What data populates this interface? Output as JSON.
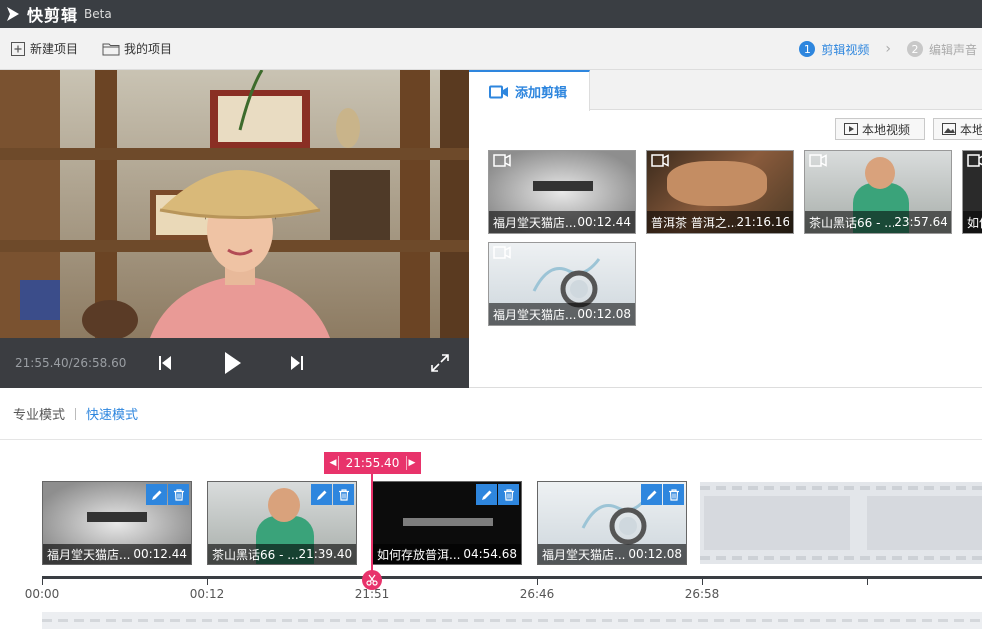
{
  "app": {
    "name": "快剪辑",
    "badge": "Beta"
  },
  "toolbar": {
    "new_project": "新建项目",
    "my_projects": "我的项目"
  },
  "steps": [
    {
      "num": "1",
      "label": "剪辑视频"
    },
    {
      "num": "2",
      "label": "编辑声音"
    }
  ],
  "player": {
    "time_readout": "21:55.40/26:58.60"
  },
  "media": {
    "tab_label": "添加剪辑",
    "local_video_label": "本地视频",
    "local_image_label": "本地",
    "clips": [
      {
        "title": "福月堂天猫店...",
        "duration": "00:12.44"
      },
      {
        "title": "普洱茶 普洱之...",
        "duration": "21:16.16"
      },
      {
        "title": "茶山黑话66 - ...",
        "duration": "23:57.64"
      },
      {
        "title": "如何",
        "duration": ""
      },
      {
        "title": "福月堂天猫店...",
        "duration": "00:12.08"
      }
    ]
  },
  "modes": {
    "pro": "专业模式",
    "quick": "快速模式"
  },
  "timeline": {
    "playhead_time": "21:55.40",
    "clips": [
      {
        "title": "福月堂天猫店...",
        "duration": "00:12.44"
      },
      {
        "title": "茶山黑话66 - ...",
        "duration": "21:39.40"
      },
      {
        "title": "如何存放普洱...",
        "duration": "04:54.68"
      },
      {
        "title": "福月堂天猫店...",
        "duration": "00:12.08"
      }
    ],
    "ticks": [
      "00:00",
      "00:12",
      "21:51",
      "26:46",
      "26:58"
    ]
  },
  "colors": {
    "accent": "#2e86de",
    "playhead": "#e8336b",
    "titlebar": "#3a3e43"
  }
}
